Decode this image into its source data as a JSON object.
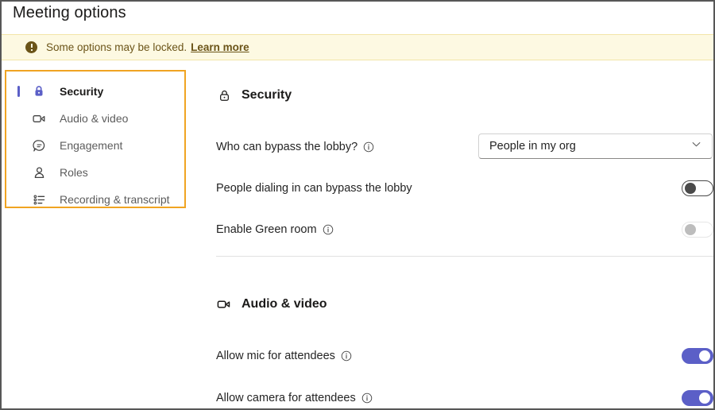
{
  "window": {
    "title": "Meeting options"
  },
  "banner": {
    "icon": "error-circle-icon",
    "text": "Some options may be locked.",
    "link_label": "Learn more",
    "bg_color": "#fdf9e2",
    "text_color": "#6b5418"
  },
  "sidebar": {
    "highlight_color": "#f0a422",
    "items": [
      {
        "label": "Security",
        "icon": "lock-icon",
        "active": true
      },
      {
        "label": "Audio & video",
        "icon": "video-camera-icon",
        "active": false
      },
      {
        "label": "Engagement",
        "icon": "chat-bubble-icon",
        "active": false
      },
      {
        "label": "Roles",
        "icon": "person-icon",
        "active": false
      },
      {
        "label": "Recording & transcript",
        "icon": "list-icon",
        "active": false
      }
    ]
  },
  "main": {
    "sections": [
      {
        "title": "Security",
        "icon": "lock-icon"
      },
      {
        "title": "Audio & video",
        "icon": "video-camera-icon"
      }
    ],
    "security": {
      "lobby_label": "Who can bypass the lobby?",
      "lobby_info_icon": "info-icon",
      "lobby_value": "People in my org",
      "lobby_chevron": "chevron-down-icon",
      "dialin_label": "People dialing in can bypass the lobby",
      "dialin_state": "off",
      "greenroom_label": "Enable Green room",
      "greenroom_info_icon": "info-icon",
      "greenroom_state": "disabled"
    },
    "audio_video": {
      "mic_label": "Allow mic for attendees",
      "mic_info_icon": "info-icon",
      "mic_state": "on",
      "camera_label": "Allow camera for attendees",
      "camera_info_icon": "info-icon",
      "camera_state": "on"
    }
  },
  "colors": {
    "brand": "#5b5fc7",
    "annotation": "#f0a422",
    "text": "#242424"
  }
}
